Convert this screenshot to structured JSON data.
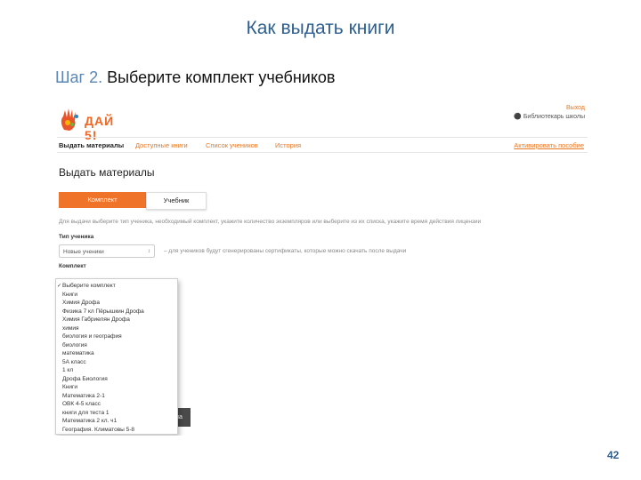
{
  "slide": {
    "title": "Как выдать книги",
    "step_num": "Шаг 2.",
    "step_text": "Выберите комплект учебников",
    "page_number": "42"
  },
  "app": {
    "brand": "ДАЙ 5!",
    "top_right": {
      "exit": "Выход",
      "user": "Библиотекарь школы"
    },
    "nav": [
      "Выдать материалы",
      "Доступные книги",
      "Список учеников",
      "История",
      "Активировать пособие"
    ],
    "heading": "Выдать материалы",
    "tabs": [
      "Комплект",
      "Учебник"
    ],
    "hint": "Для выдачи выберите тип ученика, необходимый комплект, укажите количество экземпляров или выберите из их списка, укажите время действия лицензии",
    "type_label": "Тип ученика",
    "type_value": "Новые ученики",
    "type_note": "– для учеников будут сгенерированы сертификаты, которые можно скачать после выдачи",
    "set_label": "Комплект",
    "dropdown_options": [
      "Выберите комплект",
      "Книги",
      "Химия Дрофа",
      "Физика 7 кл Пёрышкин Дрофа",
      "Химия Габриелян Дрофа",
      "химия",
      "биология и география",
      "биология",
      "математика",
      "5А класс",
      "1 кл",
      "Дрофа Биология",
      "Книги",
      "Математика 2-1",
      "ОВК 4-5 класс",
      "книги для теста 1",
      "Математика 2 кл. ч1",
      "География. Климатовы 5-8"
    ],
    "bottom_button": "на"
  }
}
